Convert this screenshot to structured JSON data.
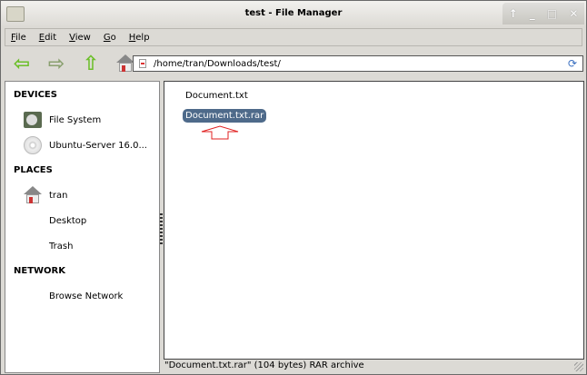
{
  "window": {
    "title": "test - File Manager",
    "buttons": [
      "↑",
      "_",
      "□",
      "✕"
    ]
  },
  "menu": [
    "File",
    "Edit",
    "View",
    "Go",
    "Help"
  ],
  "toolbar": {
    "icons": [
      "back-icon",
      "forward-icon",
      "up-icon",
      "home-icon"
    ],
    "address": "/home/tran/Downloads/test/"
  },
  "sidebar": {
    "devices_header": "DEVICES",
    "devices": [
      "File System",
      "Ubuntu-Server 16.0..."
    ],
    "places_header": "PLACES",
    "places": [
      "tran",
      "Desktop",
      "Trash"
    ],
    "network_header": "NETWORK",
    "network": [
      "Browse Network"
    ]
  },
  "files": [
    {
      "name": "Document.txt",
      "selected": false
    },
    {
      "name": "Document.txt.rar",
      "selected": true
    }
  ],
  "annotation_color": "#e02020",
  "selection_color": "#4e6a8a",
  "status": "\"Document.txt.rar\" (104 bytes) RAR archive"
}
